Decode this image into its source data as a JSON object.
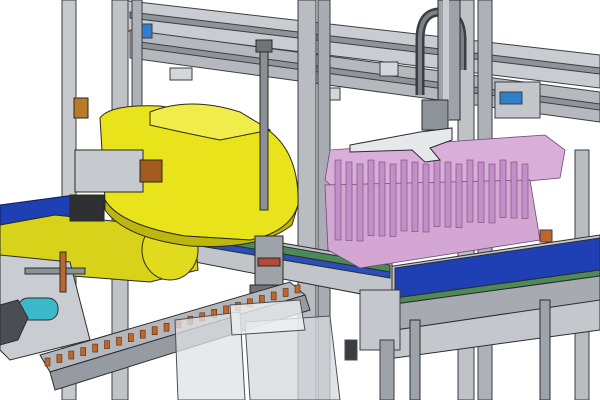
{
  "scene": {
    "kind": "3d-cad-render",
    "subject": "automated-assembly-cell",
    "colors": {
      "background": "#ffffff",
      "frame_steel": "#b9bcc1",
      "frame_edge": "#3b3d41",
      "robot_yellow": "#e8e31b",
      "robot_yellow_shade": "#bdb70d",
      "conveyor_belt_blue": "#1f3fb5",
      "conveyor_green_strip": "#4d8a55",
      "parts_pink": "#d9aed9",
      "parts_edge": "#6e4a78",
      "chain_orange": "#c0662a",
      "guard_glass": "#dfe3e6",
      "cylinder_cyan": "#3bb9c9",
      "gripper_grey": "#9ea3aa"
    }
  }
}
